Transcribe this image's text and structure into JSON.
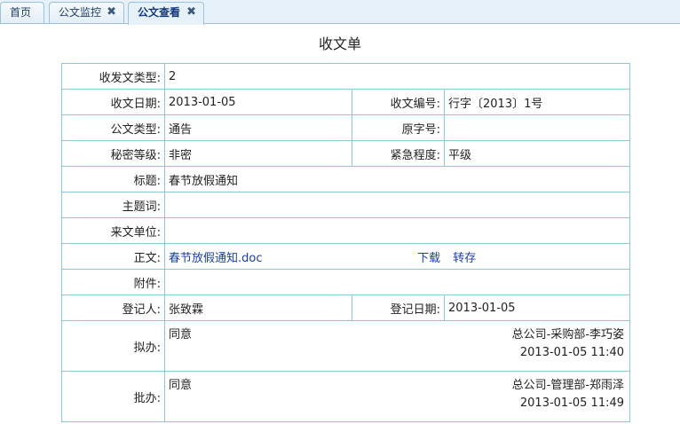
{
  "tabs": [
    {
      "label": "首页"
    },
    {
      "label": "公文监控"
    },
    {
      "label": "公文查看"
    }
  ],
  "close_glyph": "✖",
  "page_title": "收文单",
  "form": {
    "doc_io_type": {
      "label": "收发文类型:",
      "value": "2"
    },
    "receive_date": {
      "label": "收文日期:",
      "value": "2013-01-05"
    },
    "receive_no": {
      "label": "收文编号:",
      "value": "行字〔2013〕1号"
    },
    "doc_type": {
      "label": "公文类型:",
      "value": "通告"
    },
    "original_no": {
      "label": "原字号:",
      "value": ""
    },
    "secret_level": {
      "label": "秘密等级:",
      "value": "非密"
    },
    "urgency": {
      "label": "紧急程度:",
      "value": "平级"
    },
    "subject": {
      "label": "标题:",
      "value": "春节放假通知"
    },
    "keywords": {
      "label": "主题词:",
      "value": ""
    },
    "source_unit": {
      "label": "来文单位:",
      "value": ""
    },
    "body": {
      "label": "正文:",
      "file": "春节放假通知.doc",
      "download": "下载",
      "transfer": "转存"
    },
    "attachment": {
      "label": "附件:",
      "value": ""
    },
    "registrar": {
      "label": "登记人:",
      "value": "张致霖"
    },
    "register_date": {
      "label": "登记日期:",
      "value": "2013-01-05"
    },
    "draft": {
      "label": "拟办:",
      "opinion": "同意",
      "person": "总公司-采购部-李巧姿",
      "time": "2013-01-05 11:40"
    },
    "approve": {
      "label": "批办:",
      "opinion": "同意",
      "person": "总公司-管理部-郑雨泽",
      "time": "2013-01-05 11:49"
    }
  }
}
